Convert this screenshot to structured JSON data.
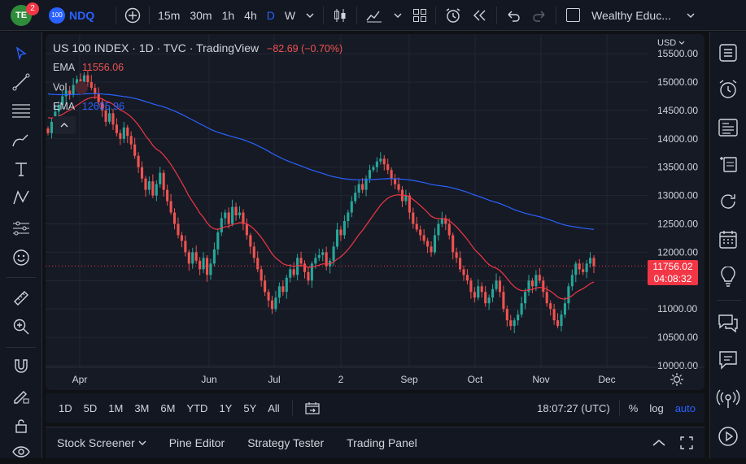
{
  "topbar": {
    "avatar_letters": "TE",
    "notif_count": "2",
    "symbol_badge": "100",
    "symbol": "NDQ",
    "intervals": [
      "15m",
      "30m",
      "1h",
      "4h",
      "D",
      "W"
    ],
    "active_interval": "D",
    "layout_name": "Wealthy Educ..."
  },
  "chart": {
    "title": "US 100 INDEX · 1D · TVC · TradingView",
    "change": "−82.69 (−0.70%)",
    "ema1_label": "EMA",
    "ema1_value": "11556.06",
    "vol_label": "Vol",
    "ema2_label": "EMA",
    "ema2_value": "12605.96",
    "currency": "USD",
    "last_price": "11756.02",
    "countdown": "04:08:32",
    "colors": {
      "up": "#26a69a",
      "down": "#ef5350",
      "ema_fast": "#f23645",
      "ema_slow": "#2962ff"
    }
  },
  "price_axis": [
    "15500.00",
    "15000.00",
    "14500.00",
    "14000.00",
    "13500.00",
    "13000.00",
    "12500.00",
    "12000.00",
    "11500.00",
    "11000.00",
    "10500.00",
    "10000.00"
  ],
  "time_axis": [
    "Apr",
    "Jun",
    "Jul",
    "2",
    "Sep",
    "Oct",
    "Nov",
    "Dec"
  ],
  "range": {
    "buttons": [
      "1D",
      "5D",
      "1M",
      "3M",
      "6M",
      "YTD",
      "1Y",
      "5Y",
      "All"
    ],
    "clock": "18:07:27 (UTC)",
    "percent": "%",
    "log": "log",
    "auto": "auto"
  },
  "bottom": {
    "tabs": [
      "Stock Screener",
      "Pine Editor",
      "Strategy Tester",
      "Trading Panel"
    ]
  },
  "chart_data": {
    "type": "candlestick",
    "title": "US 100 INDEX · 1D · TVC · TradingView",
    "currency": "USD",
    "ylim": [
      9950,
      15650
    ],
    "xlabels": [
      "Apr",
      "Jun",
      "Jul",
      "2",
      "Sep",
      "Oct",
      "Nov",
      "Dec"
    ],
    "last": 11756.02,
    "ema_fast_last": 11556.06,
    "ema_slow_last": 12605.96,
    "close": [
      14100,
      14300,
      14480,
      14600,
      14750,
      14850,
      14780,
      14950,
      15050,
      15000,
      15120,
      15000,
      14900,
      14800,
      14650,
      14500,
      14300,
      14450,
      14250,
      14100,
      14000,
      14200,
      14050,
      13900,
      13700,
      13500,
      13300,
      13100,
      13250,
      13000,
      13200,
      13400,
      13100,
      12900,
      12700,
      12500,
      12300,
      12200,
      12000,
      11800,
      12000,
      11850,
      11700,
      11900,
      11600,
      11800,
      12050,
      12350,
      12600,
      12700,
      12500,
      12800,
      12650,
      12700,
      12500,
      12300,
      12100,
      11900,
      11700,
      11500,
      11300,
      11150,
      11000,
      11200,
      11400,
      11300,
      11550,
      11700,
      11600,
      11900,
      11800,
      11650,
      11500,
      11800,
      11900,
      11950,
      12000,
      11750,
      11850,
      12100,
      12400,
      12300,
      12550,
      12700,
      12900,
      13050,
      13200,
      13100,
      13300,
      13450,
      13500,
      13600,
      13650,
      13550,
      13450,
      13300,
      13200,
      13100,
      12900,
      13000,
      12700,
      12500,
      12400,
      12300,
      12200,
      12100,
      12000,
      12300,
      12500,
      12600,
      12500,
      12300,
      12000,
      11900,
      11700,
      11600,
      11500,
      11300,
      11200,
      11400,
      11300,
      11100,
      11200,
      11350,
      11500,
      11300,
      11000,
      10800,
      10700,
      10800,
      10900,
      11100,
      11300,
      11500,
      11400,
      11600,
      11500,
      11300,
      11100,
      11000,
      10800,
      10700,
      10900,
      11100,
      11400,
      11600,
      11800,
      11700,
      11650,
      11800,
      11900,
      11756
    ]
  }
}
